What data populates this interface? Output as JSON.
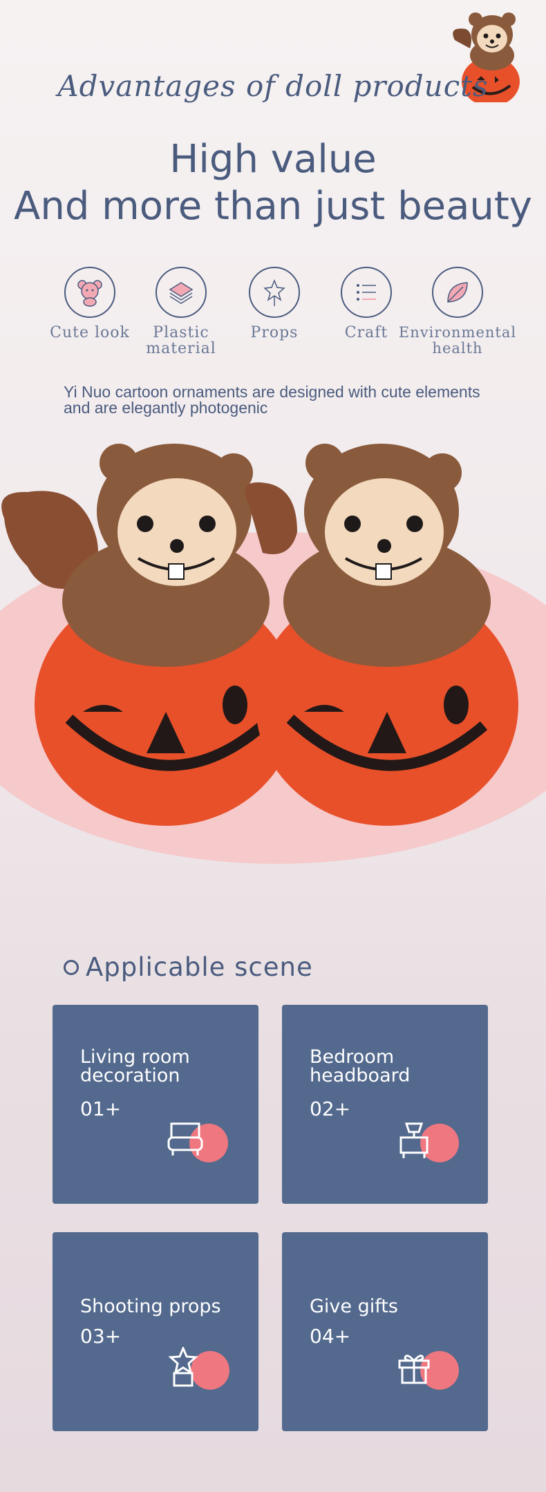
{
  "header": {
    "script_title": "Advantages of doll products",
    "headline_line1": "High value",
    "headline_line2": "And more than just beauty"
  },
  "features": [
    {
      "label_line1": "Cute look",
      "label_line2": "",
      "icon": "bear-icon"
    },
    {
      "label_line1": "Plastic",
      "label_line2": "material",
      "icon": "layers-icon"
    },
    {
      "label_line1": "Props",
      "label_line2": "",
      "icon": "star-wand-icon"
    },
    {
      "label_line1": "Craft",
      "label_line2": "",
      "icon": "list-icon"
    },
    {
      "label_line1": "Environmental",
      "label_line2": "health",
      "icon": "leaf-icon"
    }
  ],
  "description_line1": "Yi Nuo cartoon ornaments are designed with cute elements",
  "description_line2": "and are elegantly photogenic",
  "product": {
    "image_icon": "squirrel-pumpkin-toy",
    "colors": {
      "pumpkin": "#e8502a",
      "fur": "#8a5a3c",
      "face": "#f3d9bd",
      "backdrop": "#f6c9cb"
    }
  },
  "scenes": {
    "title": "Applicable scene",
    "cards": [
      {
        "title_line1": "Living room",
        "title_line2": "decoration",
        "number": "01+",
        "icon": "sofa-icon"
      },
      {
        "title_line1": "Bedroom",
        "title_line2": "headboard",
        "number": "02+",
        "icon": "nightstand-icon"
      },
      {
        "title_line1": "Shooting props",
        "title_line2": "",
        "number": "03+",
        "icon": "star-box-icon"
      },
      {
        "title_line1": "Give gifts",
        "title_line2": "",
        "number": "04+",
        "icon": "gift-icon"
      }
    ],
    "colors": {
      "card": "#53698d",
      "accent": "#ef7780"
    }
  }
}
